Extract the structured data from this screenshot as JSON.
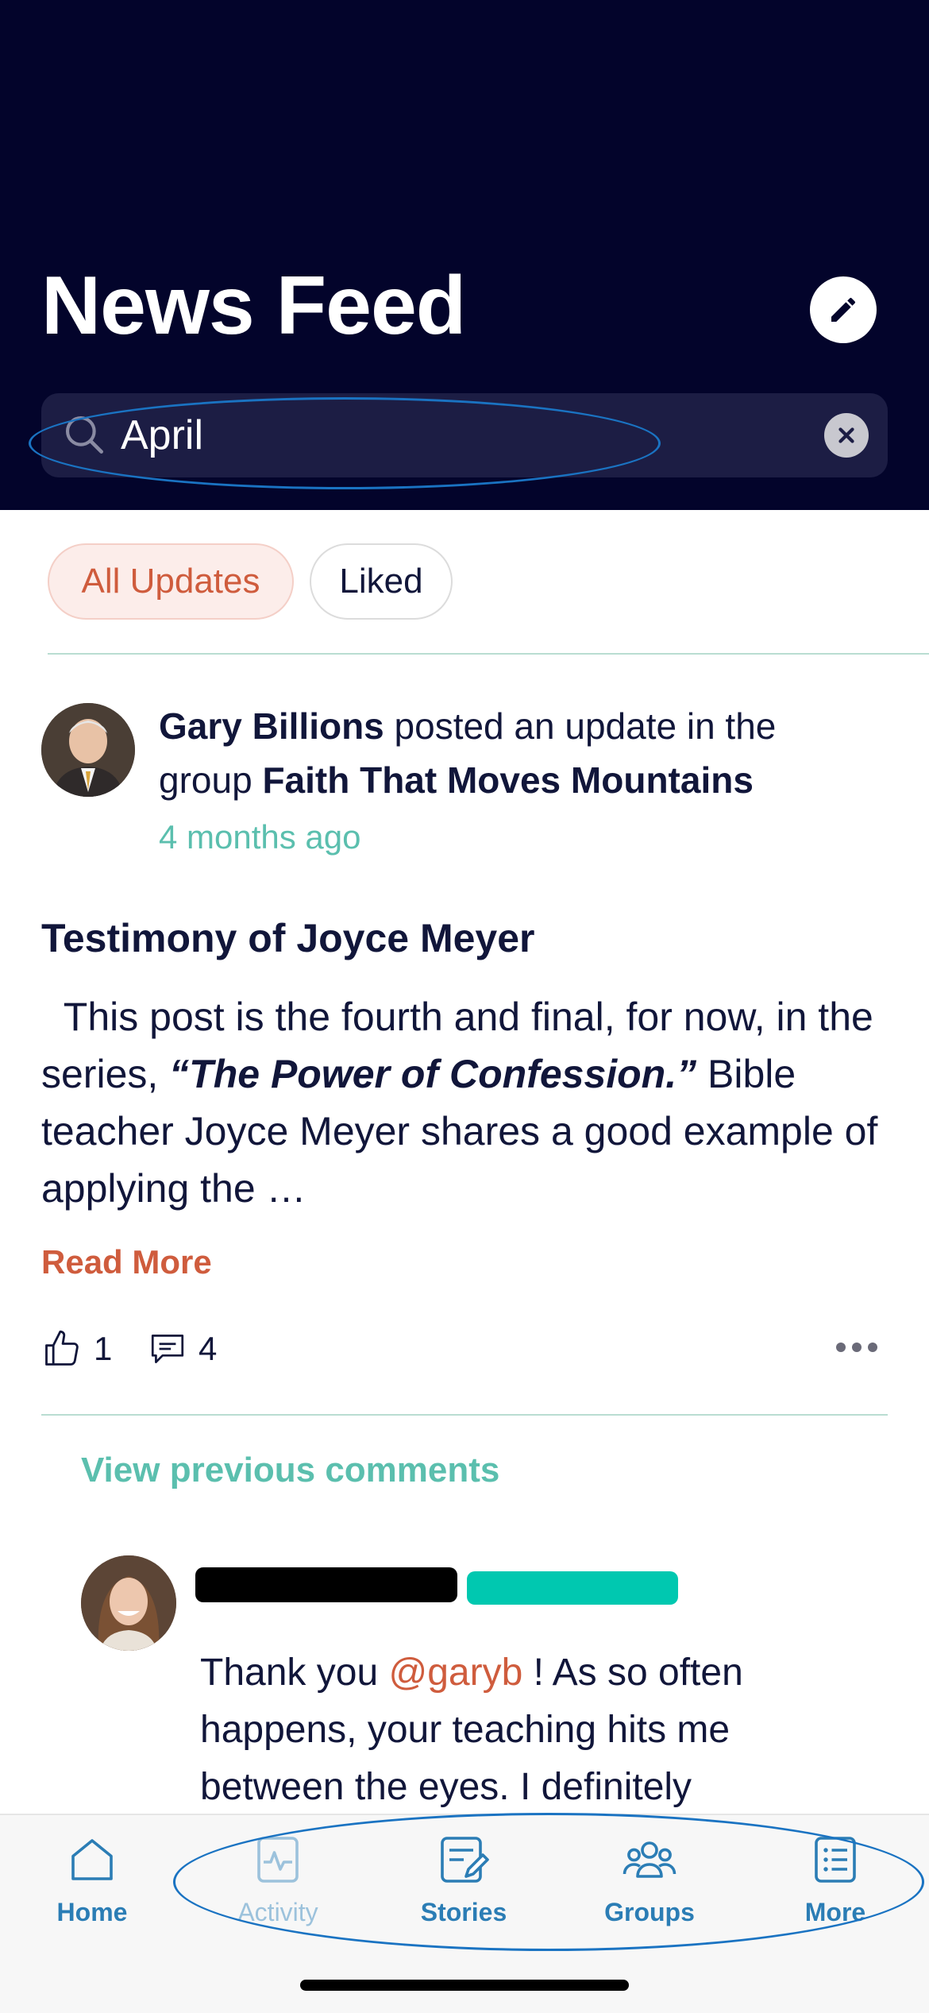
{
  "header": {
    "title": "News Feed",
    "compose_icon": "pencil-icon"
  },
  "search": {
    "value": "April",
    "placeholder": "Search",
    "icon": "search-icon",
    "clear_icon": "close-icon"
  },
  "filters": [
    {
      "label": "All Updates",
      "active": true
    },
    {
      "label": "Liked",
      "active": false
    }
  ],
  "post": {
    "author": "Gary Billions",
    "action": " posted an update in the group ",
    "group": "Faith That Moves Mountains",
    "time": "4 months ago",
    "title": "Testimony of Joyce Meyer",
    "body_start": "  This post is the fourth and final, for now, in the series, ",
    "body_emphasis": "“The Power of Confession.”",
    "body_end": " Bible teacher Joyce Meyer shares a good example of applying the …",
    "read_more": "Read More",
    "likes": "1",
    "comments": "4"
  },
  "comments": {
    "view_previous": "View previous comments",
    "items": [
      {
        "text_before": "Thank you ",
        "mention": "@garyb",
        "text_after": "  ! As so often happens, your teaching hits me between the eyes. I definitely"
      }
    ]
  },
  "nav": {
    "items": [
      {
        "label": "Home",
        "icon": "home-icon"
      },
      {
        "label": "Activity",
        "icon": "activity-icon"
      },
      {
        "label": "Stories",
        "icon": "stories-icon"
      },
      {
        "label": "Groups",
        "icon": "groups-icon"
      },
      {
        "label": "More",
        "icon": "more-list-icon"
      }
    ]
  },
  "colors": {
    "header_bg": "#03042b",
    "accent_coral": "#cf5c3d",
    "accent_teal": "#5bbfae",
    "nav_blue": "#2b7db5",
    "annotation_blue": "#1a73c2"
  }
}
